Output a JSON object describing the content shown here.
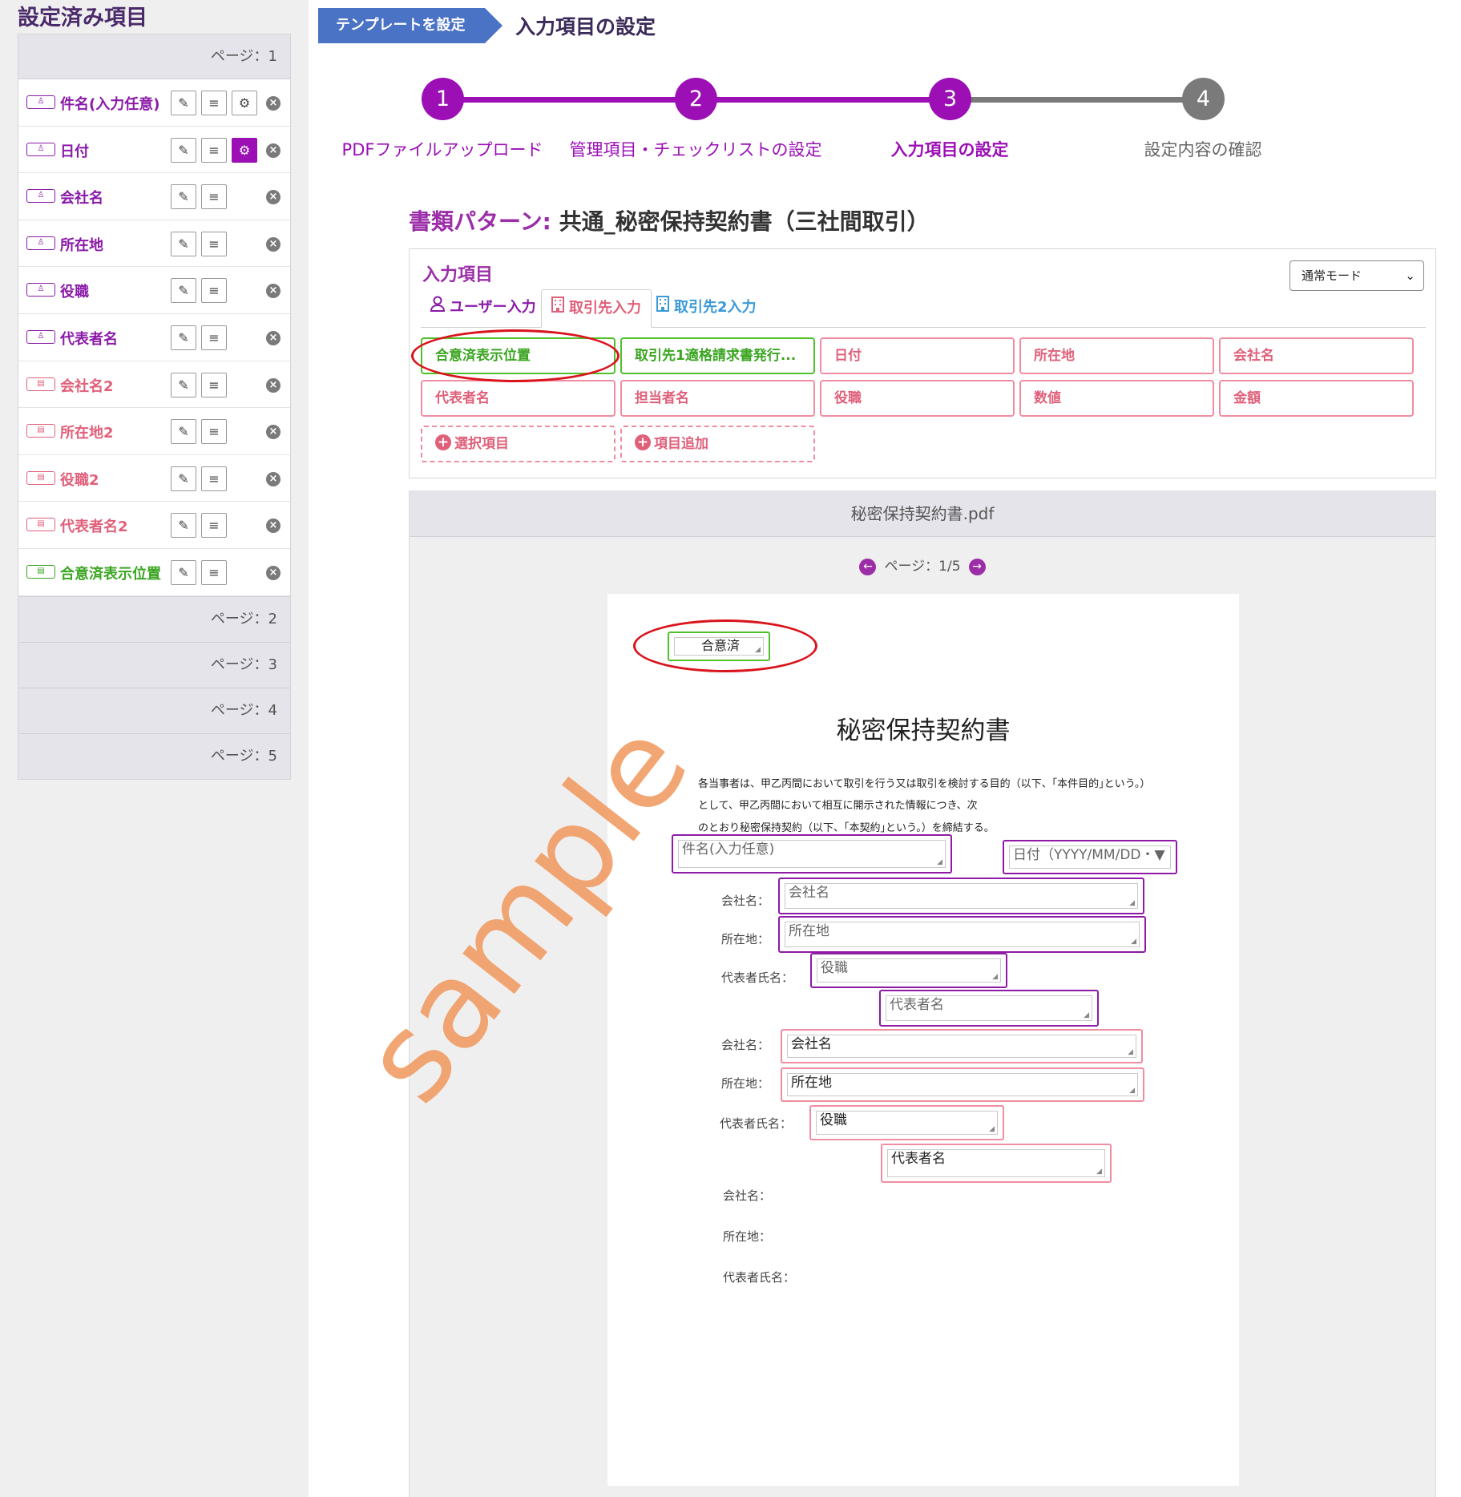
{
  "sidebar": {
    "title": "設定済み項目",
    "page1": "ページ：1",
    "items": [
      {
        "label": "件名(入力任意)",
        "kind": "user",
        "icon": "user-icon",
        "gear": true,
        "gear_active": false,
        "list_icon": "align-left-icon"
      },
      {
        "label": "日付",
        "kind": "user",
        "icon": "user-icon",
        "gear": true,
        "gear_active": true,
        "list_icon": "align-left-icon"
      },
      {
        "label": "会社名",
        "kind": "user",
        "icon": "user-icon",
        "gear": false,
        "gear_active": false,
        "list_icon": "align-left-icon"
      },
      {
        "label": "所在地",
        "kind": "user",
        "icon": "user-icon",
        "gear": false,
        "gear_active": false,
        "list_icon": "align-left-icon"
      },
      {
        "label": "役職",
        "kind": "user",
        "icon": "user-icon",
        "gear": false,
        "gear_active": false,
        "list_icon": "align-left-icon"
      },
      {
        "label": "代表者名",
        "kind": "user",
        "icon": "user-icon",
        "gear": false,
        "gear_active": false,
        "list_icon": "align-left-icon"
      },
      {
        "label": "会社名2",
        "kind": "client",
        "icon": "building-icon",
        "gear": false,
        "gear_active": false,
        "list_icon": "align-left-icon"
      },
      {
        "label": "所在地2",
        "kind": "client",
        "icon": "building-icon",
        "gear": false,
        "gear_active": false,
        "list_icon": "align-left-icon"
      },
      {
        "label": "役職2",
        "kind": "client",
        "icon": "building-icon",
        "gear": false,
        "gear_active": false,
        "list_icon": "align-left-icon"
      },
      {
        "label": "代表者名2",
        "kind": "client",
        "icon": "building-icon",
        "gear": false,
        "gear_active": false,
        "list_icon": "align-left-icon"
      },
      {
        "label": "合意済表示位置",
        "kind": "green",
        "icon": "building-icon",
        "gear": false,
        "gear_active": false,
        "list_icon": "align-center-icon"
      }
    ],
    "other_pages": [
      "ページ：2",
      "ページ：3",
      "ページ：4",
      "ページ：5"
    ]
  },
  "breadcrumb": {
    "step": "テンプレートを設定",
    "title": "入力項目の設定"
  },
  "stepper": {
    "steps": [
      {
        "num": "1",
        "label": "PDFファイルアップロード",
        "state": "done"
      },
      {
        "num": "2",
        "label": "管理項目・チェックリストの設定",
        "state": "done"
      },
      {
        "num": "3",
        "label": "入力項目の設定",
        "state": "current"
      },
      {
        "num": "4",
        "label": "設定内容の確認",
        "state": "todo"
      }
    ]
  },
  "pattern": {
    "key": "書類パターン:",
    "value": "共通_秘密保持契約書（三社間取引）"
  },
  "input_panel": {
    "title": "入力項目",
    "mode": "通常モード",
    "tabs": [
      {
        "label": "ユーザー入力",
        "icon": "user-icon"
      },
      {
        "label": "取引先入力",
        "icon": "building-icon"
      },
      {
        "label": "取引先2入力",
        "icon": "building-icon"
      }
    ],
    "chips": [
      {
        "label": "合意済表示位置",
        "style": "green"
      },
      {
        "label": "取引先1適格請求書発行...",
        "style": "green"
      },
      {
        "label": "日付",
        "style": "pink"
      },
      {
        "label": "所在地",
        "style": "pink"
      },
      {
        "label": "会社名",
        "style": "pink"
      },
      {
        "label": "代表者名",
        "style": "pink"
      },
      {
        "label": "担当者名",
        "style": "pink"
      },
      {
        "label": "役職",
        "style": "pink"
      },
      {
        "label": "数値",
        "style": "pink"
      },
      {
        "label": "金額",
        "style": "pink"
      }
    ],
    "add_select": "選択項目",
    "add_item": "項目追加"
  },
  "viewer": {
    "filename": "秘密保持契約書.pdf",
    "page_indicator": "ページ：1/5",
    "prev_icon": "arrow-left-icon",
    "next_icon": "arrow-right-icon"
  },
  "pdf": {
    "agreed_field": "合意済",
    "title": "秘密保持契約書",
    "para1": "各当事者は、甲乙丙間において取引を行う又は取引を検討する目的（以下、｢本件目的｣という。）",
    "para2": "として、甲乙丙間において相互に開示された情報につき、次",
    "para3": "のとおり秘密保持契約（以下、｢本契約｣という。）を締結する。",
    "subject_field": "件名(入力任意)",
    "date_field": "日付（YYYY/MM/DD・▼",
    "labels": {
      "company": "会社名：",
      "address": "所在地：",
      "rep": "代表者氏名："
    },
    "user_fields": {
      "company": "会社名",
      "address": "所在地",
      "position": "役職",
      "rep": "代表者名"
    },
    "client_fields": {
      "company": "会社名",
      "address": "所在地",
      "position": "役職",
      "rep": "代表者名"
    },
    "watermark": "sample"
  },
  "colors": {
    "accent_purple": "#9b0fb5",
    "client_pink": "#e0607a",
    "agreed_green": "#3aa521",
    "breadcrumb_blue": "#4a73c6",
    "step_inactive": "#7a7a7a",
    "highlight_red": "#d9141c"
  }
}
